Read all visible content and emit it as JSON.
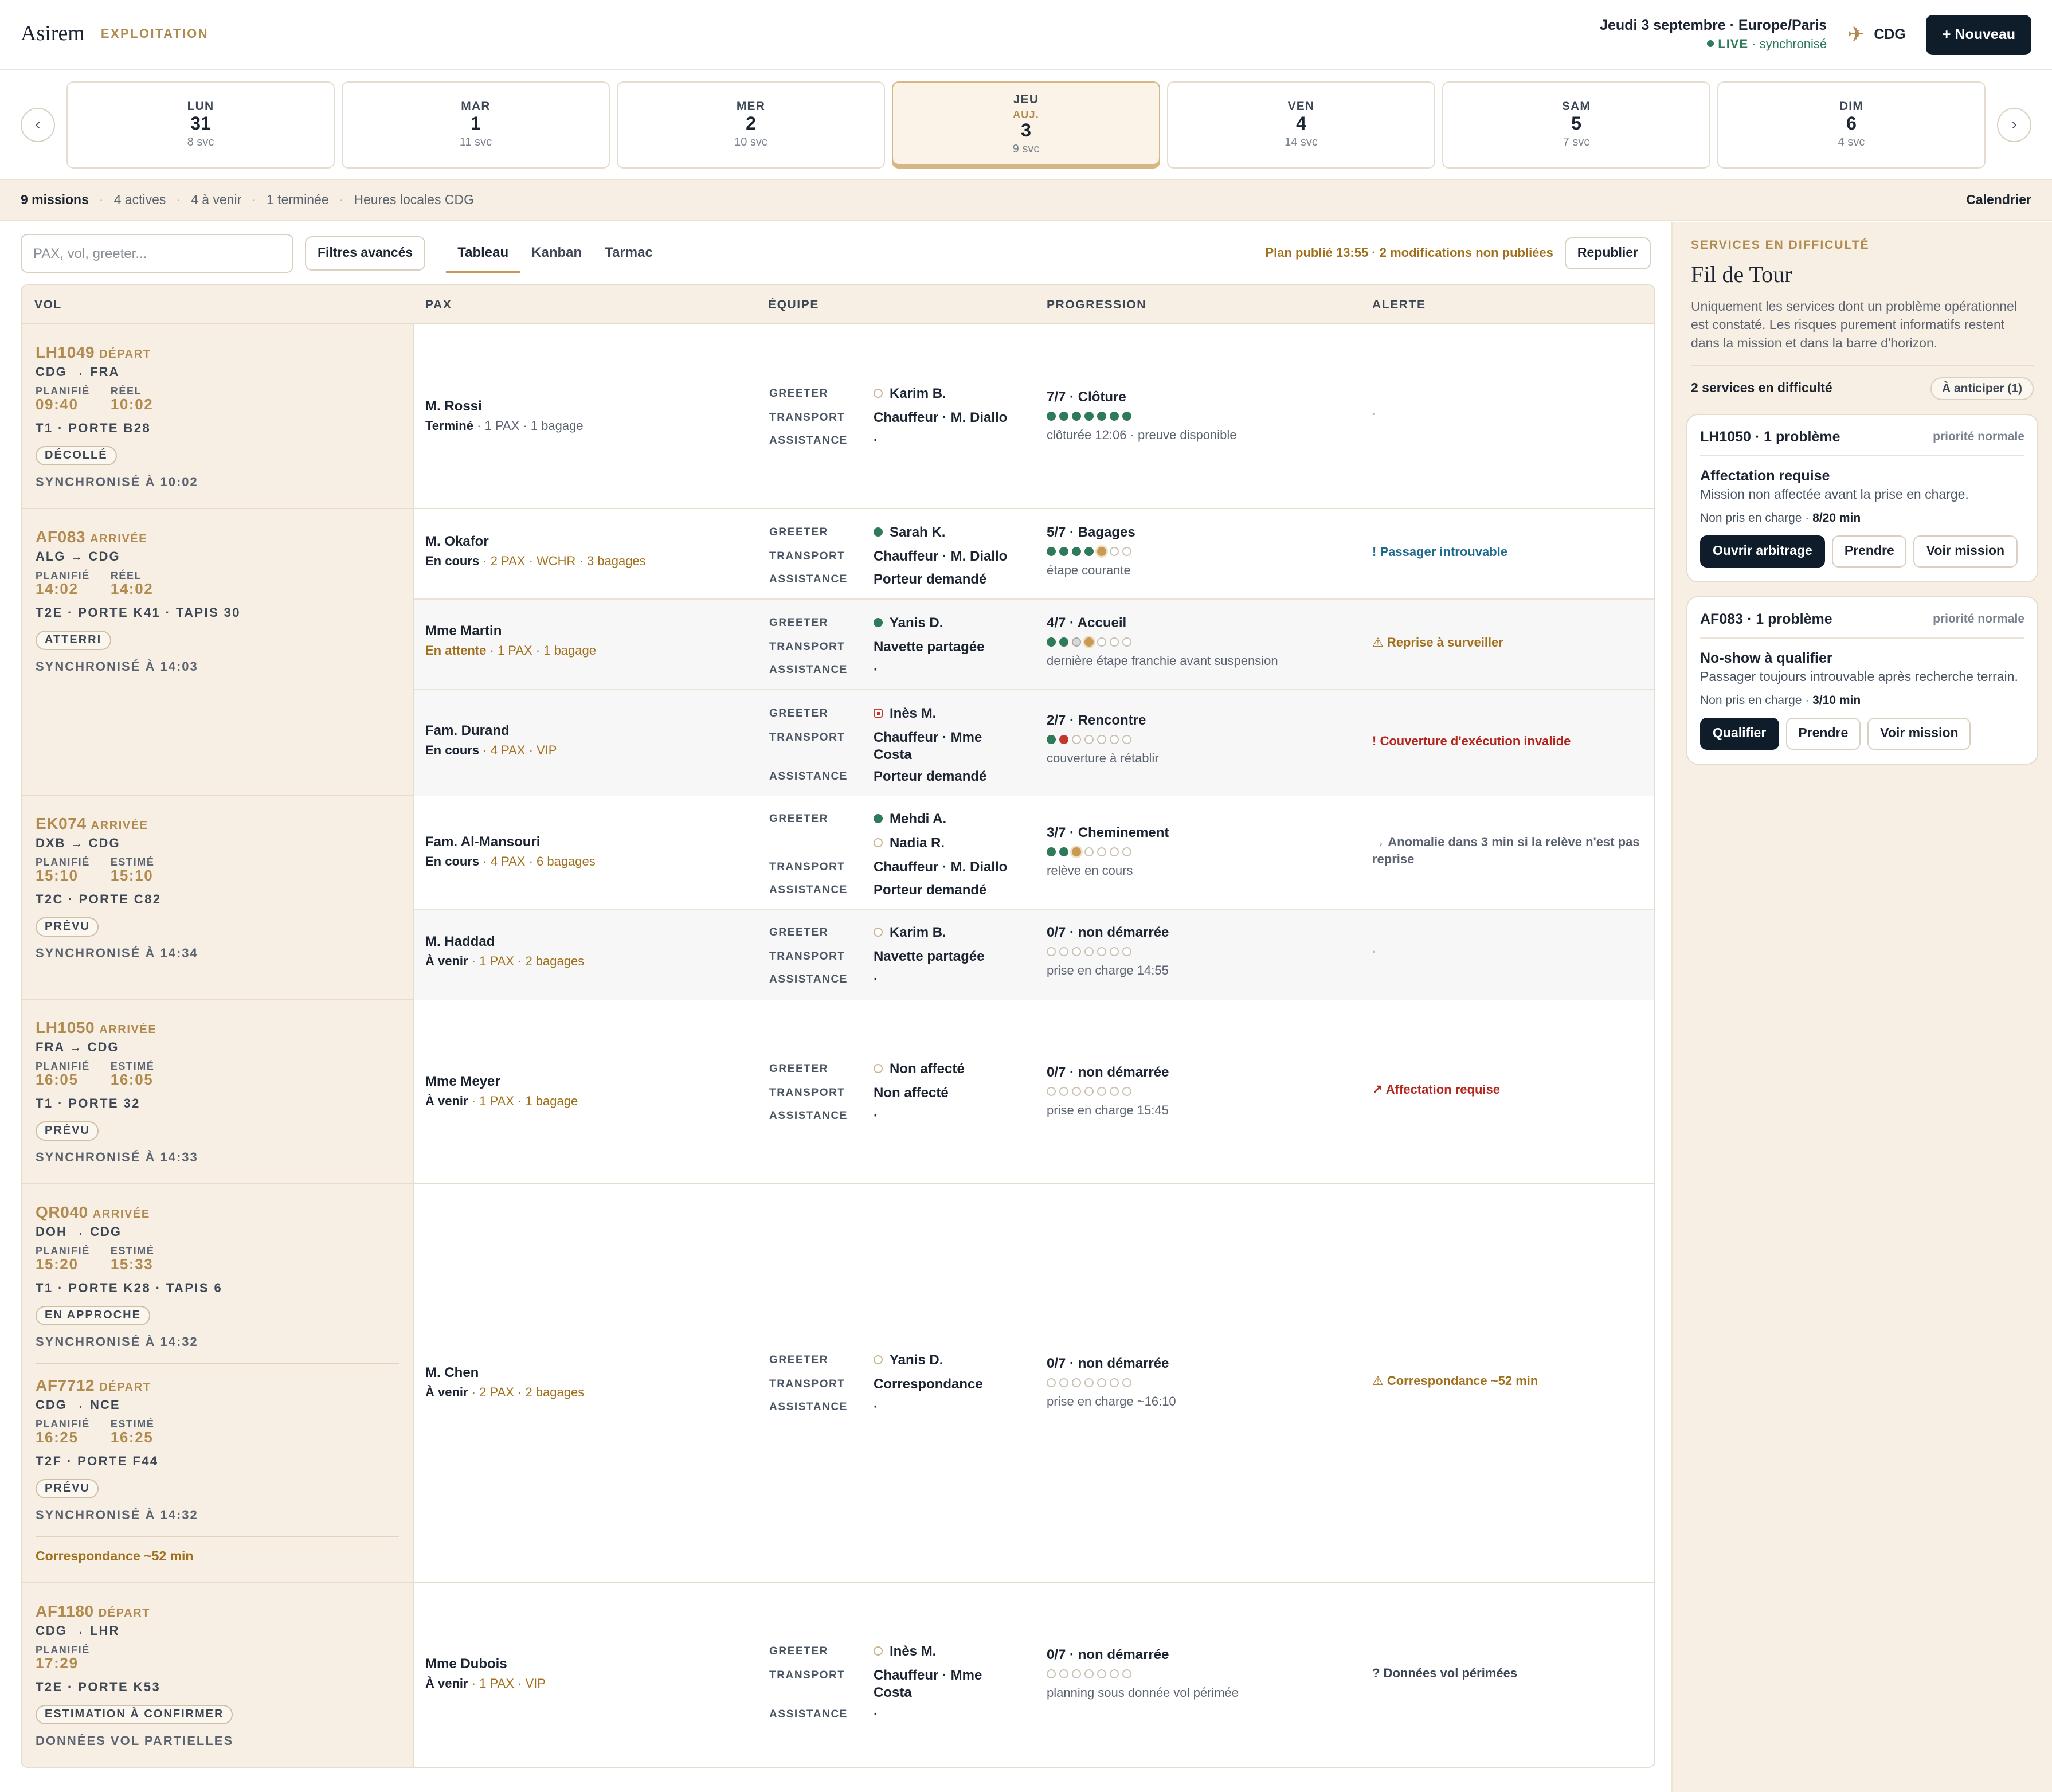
{
  "header": {
    "brand": "Asirem",
    "section": "EXPLOITATION",
    "date_line": "Jeudi 3 septembre · Europe/Paris",
    "live_label": "LIVE",
    "live_suffix": "· synchronisé",
    "airport": "CDG",
    "airport_icon": "plane-icon",
    "new_button": "+ Nouveau"
  },
  "days": [
    {
      "dow": "LUN",
      "num": "31",
      "svc": "8 svc",
      "today": false,
      "tag": ""
    },
    {
      "dow": "MAR",
      "num": "1",
      "svc": "11 svc",
      "today": false,
      "tag": ""
    },
    {
      "dow": "MER",
      "num": "2",
      "svc": "10 svc",
      "today": false,
      "tag": ""
    },
    {
      "dow": "JEU",
      "num": "3",
      "svc": "9 svc",
      "today": true,
      "tag": "AUJ."
    },
    {
      "dow": "VEN",
      "num": "4",
      "svc": "14 svc",
      "today": false,
      "tag": ""
    },
    {
      "dow": "SAM",
      "num": "5",
      "svc": "7 svc",
      "today": false,
      "tag": ""
    },
    {
      "dow": "DIM",
      "num": "6",
      "svc": "4 svc",
      "today": false,
      "tag": ""
    }
  ],
  "summary": {
    "missions": "9 missions",
    "actives": "4 actives",
    "upcoming": "4 à venir",
    "done": "1 terminée",
    "timezone": "Heures locales CDG",
    "calendar": "Calendrier"
  },
  "toolbar": {
    "search_placeholder": "PAX, vol, greeter...",
    "filters": "Filtres avancés",
    "tabs": [
      "Tableau",
      "Kanban",
      "Tarmac"
    ],
    "active_tab": "Tableau",
    "plan_status": "Plan publié 13:55 · 2 modifications non publiées",
    "republish": "Republier"
  },
  "columns": [
    "VOL",
    "PAX",
    "ÉQUIPE",
    "PROGRESSION",
    "ALERTE"
  ],
  "team_roles": {
    "greeter": "GREETER",
    "transport": "TRANSPORT",
    "assistance": "ASSISTANCE"
  },
  "flights": {
    "lh1049": {
      "code": "LH1049",
      "kind": "DÉPART",
      "route": "CDG → FRA",
      "l1": "PLANIFIÉ",
      "t1": "09:40",
      "l2": "RÉEL",
      "t2": "10:02",
      "gate": "T1 · PORTE B28",
      "badge": "DÉCOLLÉ",
      "sync": "SYNCHRONISÉ À 10:02"
    },
    "af083": {
      "code": "AF083",
      "kind": "ARRIVÉE",
      "route": "ALG → CDG",
      "l1": "PLANIFIÉ",
      "t1": "14:02",
      "l2": "RÉEL",
      "t2": "14:02",
      "gate": "T2E · PORTE K41 · TAPIS 30",
      "badge": "ATTERRI",
      "sync": "SYNCHRONISÉ À 14:03"
    },
    "ek074": {
      "code": "EK074",
      "kind": "ARRIVÉE",
      "route": "DXB → CDG",
      "l1": "PLANIFIÉ",
      "t1": "15:10",
      "l2": "ESTIMÉ",
      "t2": "15:10",
      "gate": "T2C · PORTE C82",
      "badge": "PRÉVU",
      "sync": "SYNCHRONISÉ À 14:34"
    },
    "lh1050": {
      "code": "LH1050",
      "kind": "ARRIVÉE",
      "route": "FRA → CDG",
      "l1": "PLANIFIÉ",
      "t1": "16:05",
      "l2": "ESTIMÉ",
      "t2": "16:05",
      "gate": "T1 · PORTE 32",
      "badge": "PRÉVU",
      "sync": "SYNCHRONISÉ À 14:33"
    },
    "qr040": {
      "code": "QR040",
      "kind": "ARRIVÉE",
      "route": "DOH → CDG",
      "l1": "PLANIFIÉ",
      "t1": "15:20",
      "l2": "ESTIMÉ",
      "t2": "15:33",
      "gate": "T1 · PORTE K28 · TAPIS 6",
      "badge": "EN APPROCHE",
      "sync": "SYNCHRONISÉ À 14:32"
    },
    "af7712": {
      "code": "AF7712",
      "kind": "DÉPART",
      "route": "CDG → NCE",
      "l1": "PLANIFIÉ",
      "t1": "16:25",
      "l2": "ESTIMÉ",
      "t2": "16:25",
      "gate": "T2F · PORTE F44",
      "badge": "PRÉVU",
      "sync": "SYNCHRONISÉ À 14:32",
      "corr": "Correspondance ~52 min"
    },
    "af1180": {
      "code": "AF1180",
      "kind": "DÉPART",
      "route": "CDG → LHR",
      "l1": "PLANIFIÉ",
      "t1": "17:29",
      "badge": "ESTIMATION À CONFIRMER",
      "gate": "T2E · PORTE K53",
      "sync": "DONNÉES VOL PARTIELLES"
    }
  },
  "missions": {
    "rossi": {
      "name": "M. Rossi",
      "status": "Terminé",
      "meta": "· 1 PAX · 1 bagage",
      "greeter": "Karim B.",
      "transport": "Chauffeur · M. Diallo",
      "assistance": "·",
      "progress": "7/7 · Clôture",
      "note": "clôturée 12:06 · preuve disponible",
      "alert": "·"
    },
    "okafor": {
      "name": "M. Okafor",
      "status": "En cours",
      "meta": "· 2 PAX · WCHR · 3 bagages",
      "greeter": "Sarah K.",
      "transport": "Chauffeur · M. Diallo",
      "assistance": "Porteur demandé",
      "progress": "5/7 · Bagages",
      "note": "étape courante",
      "alert": "! Passager introuvable"
    },
    "martin": {
      "name": "Mme Martin",
      "status": "En attente",
      "meta": "· 1 PAX · 1 bagage",
      "greeter": "Yanis D.",
      "transport": "Navette partagée",
      "assistance": "·",
      "progress": "4/7 · Accueil",
      "note": "dernière étape franchie avant suspension",
      "alert": "⚠ Reprise à surveiller"
    },
    "durand": {
      "name": "Fam. Durand",
      "status": "En cours",
      "meta": "· 4 PAX · VIP",
      "greeter": "Inès M.",
      "transport": "Chauffeur · Mme Costa",
      "assistance": "Porteur demandé",
      "progress": "2/7 · Rencontre",
      "note": "couverture à rétablir",
      "alert": "! Couverture d'exécution invalide"
    },
    "almansouri": {
      "name": "Fam. Al-Mansouri",
      "status": "En cours",
      "meta": "· 4 PAX · 6 bagages",
      "greeter": "Mehdi A.",
      "greeter2": "Nadia R.",
      "transport": "Chauffeur · M. Diallo",
      "assistance": "Porteur demandé",
      "progress": "3/7 · Cheminement",
      "note": "relève en cours",
      "alert": "→ Anomalie dans 3 min si la relève n'est pas reprise"
    },
    "haddad": {
      "name": "M. Haddad",
      "status": "À venir",
      "meta": "· 1 PAX · 2 bagages",
      "greeter": "Karim B.",
      "transport": "Navette partagée",
      "assistance": "·",
      "progress": "0/7 · non démarrée",
      "note": "prise en charge 14:55",
      "alert": "·"
    },
    "meyer": {
      "name": "Mme Meyer",
      "status": "À venir",
      "meta": "· 1 PAX · 1 bagage",
      "greeter": "Non affecté",
      "transport": "Non affecté",
      "assistance": "·",
      "progress": "0/7 · non démarrée",
      "note": "prise en charge 15:45",
      "alert": "↗ Affectation requise"
    },
    "chen": {
      "name": "M. Chen",
      "status": "À venir",
      "meta": "· 2 PAX · 2 bagages",
      "greeter": "Yanis D.",
      "transport": "Correspondance",
      "assistance": "·",
      "progress": "0/7 · non démarrée",
      "note": "prise en charge ~16:10",
      "alert": "⚠ Correspondance ~52 min"
    },
    "dubois": {
      "name": "Mme Dubois",
      "status": "À venir",
      "meta": "· 1 PAX · VIP",
      "greeter": "Inès M.",
      "transport": "Chauffeur · Mme Costa",
      "assistance": "·",
      "progress": "0/7 · non démarrée",
      "note": "planning sous donnée vol périmée",
      "alert": "? Données vol périmées"
    }
  },
  "progress_steps": {
    "rossi": 7,
    "okafor": 5,
    "martin": 4,
    "durand": 2,
    "almansouri": 3,
    "haddad": 0,
    "meyer": 0,
    "chen": 0,
    "dubois": 0
  },
  "panel": {
    "eyebrow": "SERVICES EN DIFFICULTÉ",
    "title": "Fil de Tour",
    "description": "Uniquement les services dont un problème opérationnel est constaté. Les risques purement informatifs restent dans la mission et dans la barre d'horizon.",
    "count": "2 services en difficulté",
    "anticipate": "À anticiper (1)",
    "cards": [
      {
        "title": "LH1050 · 1 problème",
        "priority": "priorité normale",
        "issue": "Affectation requise",
        "desc": "Mission non affectée avant la prise en charge.",
        "meta_prefix": "Non pris en charge ·",
        "meta_value": "8/20 min",
        "primary": "Ouvrir arbitrage",
        "take": "Prendre",
        "view": "Voir mission"
      },
      {
        "title": "AF083 · 1 problème",
        "priority": "priorité normale",
        "issue": "No-show à qualifier",
        "desc": "Passager toujours introuvable après recherche terrain.",
        "meta_prefix": "Non pris en charge ·",
        "meta_value": "3/10 min",
        "primary": "Qualifier",
        "take": "Prendre",
        "view": "Voir mission"
      }
    ]
  },
  "colors": {
    "accent_gold": "#b08a4e",
    "navy": "#0f1d2b",
    "green": "#2f7a5b",
    "red": "#b3261e",
    "blue": "#1e6a8c"
  }
}
